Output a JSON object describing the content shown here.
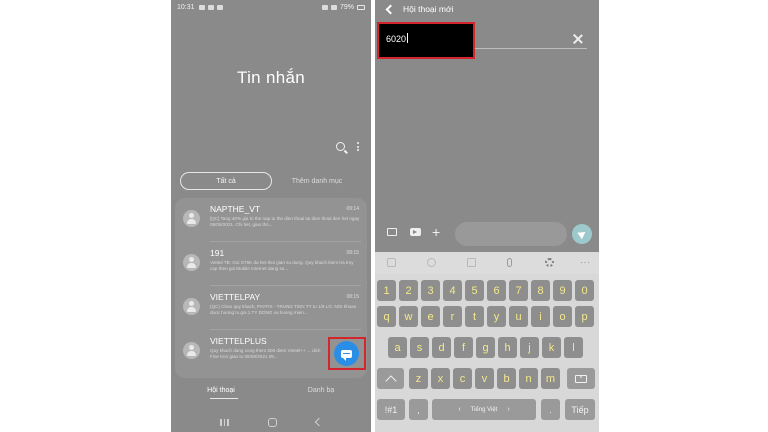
{
  "left_screen": {
    "status_bar": {
      "time": "10:31",
      "battery": "79%"
    },
    "title": "Tin nhắn",
    "filter": {
      "all_label": "Tất cả",
      "more_label": "Thêm danh mục"
    },
    "conversations": [
      {
        "name": "NAPTHE_VT",
        "time": "09:14",
        "preview": "[QC] Tang 40% gia tri the nap tu the dien thoai tai dien thoai den het ngay 08/09/2021. Chi tiet, giao tho..."
      },
      {
        "name": "191",
        "time": "08:15",
        "preview": "Viettel TB: Goi ST5K da het thoi gian su dung. Quy khach kiem tra truy cap theo goi Mobile Internet dang su..."
      },
      {
        "name": "VIETTELPAY",
        "time": "08:15",
        "preview": "(QC) Chao quy khach, PAYFIX - TRUNG TIEN TY tu 1/9 LO. NOI khoan duoc huong tu goi 1 TY DONG va huong mien..."
      },
      {
        "name": "VIETTELPLUS",
        "time": "",
        "preview": "Quy khach dang cong them 500 diem Viettel++ ... dich Fine tron gian tu 06/09/2021 08..."
      }
    ],
    "tabs": {
      "conversations": "Hội thoại",
      "contacts": "Danh bạ"
    }
  },
  "right_screen": {
    "header_title": "Hội thoại mới",
    "recipient_value": "6020",
    "keyboard": {
      "number_row": [
        "1",
        "2",
        "3",
        "4",
        "5",
        "6",
        "7",
        "8",
        "9",
        "0"
      ],
      "row1": [
        "q",
        "w",
        "e",
        "r",
        "t",
        "y",
        "u",
        "i",
        "o",
        "p"
      ],
      "row2": [
        "a",
        "s",
        "d",
        "f",
        "g",
        "h",
        "j",
        "k",
        "l"
      ],
      "row3": [
        "z",
        "x",
        "c",
        "v",
        "b",
        "n",
        "m"
      ],
      "symbols_label": "!#1",
      "comma_label": ",",
      "space_label": "Tiếng Việt",
      "period_label": ".",
      "enter_label": "Tiếp"
    }
  },
  "colors": {
    "highlight_box": "#d2252c",
    "fab": "#2a8ee6",
    "key_text": "#f4e98a"
  }
}
